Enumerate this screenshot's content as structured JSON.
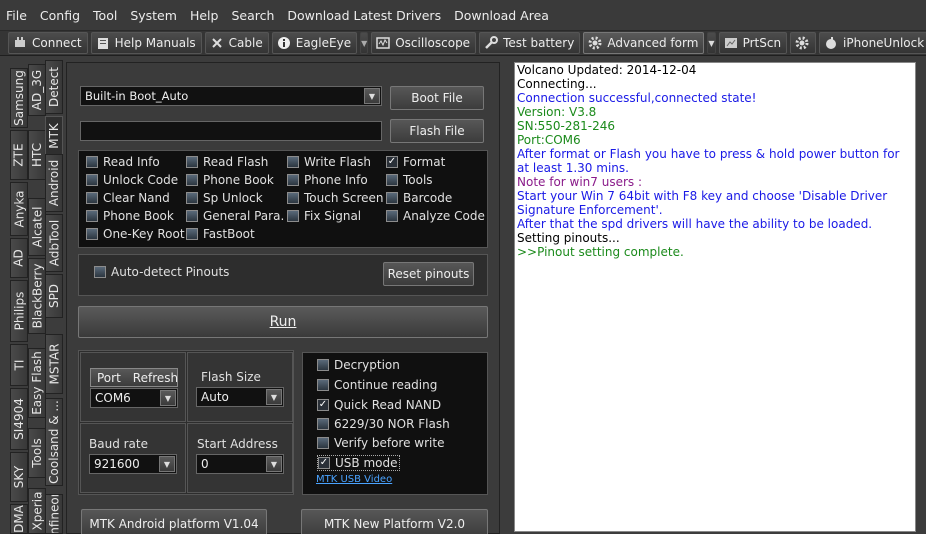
{
  "menu": [
    "File",
    "Config",
    "Tool",
    "System",
    "Help",
    "Search",
    "Download Latest Drivers",
    "Download Area"
  ],
  "toolbar": {
    "connect": "Connect",
    "help_manuals": "Help Manuals",
    "cable": "Cable",
    "eagleeye": "EagleEye",
    "oscilloscope": "Oscilloscope",
    "test_battery": "Test battery",
    "advanced_form": "Advanced form",
    "prtscn": "PrtScn",
    "iphoneunlock": "iPhoneUnlock"
  },
  "tabs": {
    "col1": [
      "Samsung",
      "ZTE",
      "Anyka",
      "AD",
      "Philips",
      "TI",
      "SI4904",
      "SKY",
      "DMA"
    ],
    "col2": [
      "AD_3G",
      "HTC",
      "Alcatel",
      "BlackBerry",
      "Easy Flash",
      "Tools",
      "Xperia"
    ],
    "col3": [
      "Detect",
      "MTK",
      "Android",
      "AdbTool",
      "SPD",
      "MSTAR",
      "Coolsand & ...",
      "Infineon"
    ]
  },
  "main": {
    "boot_select": "Built-in Boot_Auto",
    "boot_file_btn": "Boot File",
    "flash_file_btn": "Flash File",
    "options": [
      [
        "Read Info",
        "Read Flash",
        "Write Flash",
        "Format"
      ],
      [
        "Unlock Code",
        "Phone Book",
        "Phone Info",
        "Tools"
      ],
      [
        "Clear Nand",
        "Sp Unlock",
        "Touch Screen",
        "Barcode"
      ],
      [
        "Phone Book",
        "General Para.",
        "Fix Signal",
        "Analyze Code"
      ],
      [
        "One-Key Root",
        "FastBoot"
      ]
    ],
    "auto_detect": "Auto-detect Pinouts",
    "reset_pinouts": "Reset pinouts",
    "run": "Run",
    "port_label": "Port",
    "refresh_label": "Refresh",
    "port_value": "COM6",
    "flash_size_label": "Flash Size",
    "flash_size_value": "Auto",
    "baud_label": "Baud rate",
    "baud_value": "921600",
    "start_address_label": "Start Address",
    "start_address_value": "0",
    "flags": [
      "Decryption",
      "Continue reading",
      "Quick Read NAND",
      "6229/30 NOR Flash",
      "Verify before write",
      "USB mode"
    ],
    "flags_checked": [
      false,
      false,
      true,
      false,
      false,
      true
    ],
    "usb_video": "MTK USB Video",
    "android_platform": "MTK Android platform V1.04",
    "new_platform": "MTK New Platform V2.0"
  },
  "log": [
    {
      "text": "Volcano Updated: 2014-12-04",
      "color": "black"
    },
    {
      "text": "  Connecting...",
      "color": "black"
    },
    {
      "text": "  Connection successful,connected state!",
      "color": "blue"
    },
    {
      "text": "  Version: V3.8",
      "color": "green"
    },
    {
      "text": "  SN:550-281-246",
      "color": "green"
    },
    {
      "text": "  Port:COM6",
      "color": "green"
    },
    {
      "text": "  After format or Flash you have to press & hold power button for at least 1.30 mins.",
      "color": "blue"
    },
    {
      "text": "  Note for win7 users :",
      "color": "purple"
    },
    {
      "text": "  Start your Win 7 64bit with F8 key and choose 'Disable Driver Signature Enforcement'.",
      "color": "blue"
    },
    {
      "text": "  After that the spd drivers will have the ability to be loaded.",
      "color": "blue"
    },
    {
      "text": "  Setting pinouts...",
      "color": "black"
    },
    {
      "text": ">>Pinout setting complete.",
      "color": "green"
    }
  ]
}
